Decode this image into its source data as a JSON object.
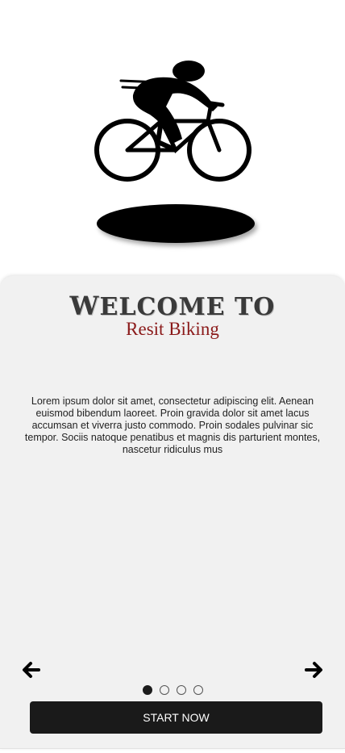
{
  "welcome": {
    "title_first": "W",
    "title_rest": "ELCOME TO",
    "subtitle": "Resit Biking",
    "description": "Lorem ipsum dolor sit amet, consectetur adipiscing elit. Aenean euismod bibendum laoreet. Proin gravida dolor sit amet lacus accumsan et viverra justo commodo. Proin sodales pulvinar sic tempor. Sociis natoque penatibus et magnis dis parturient montes, nascetur ridiculus mus"
  },
  "pager": {
    "pages": 4,
    "active_page": 1
  },
  "actions": {
    "start_label": "START NOW",
    "prev_icon": "arrow-left-icon",
    "next_icon": "arrow-right-icon"
  },
  "colors": {
    "subtitle": "#8b1a1a",
    "button_bg": "#1a1a1a",
    "card_bg": "#f1f1f1"
  }
}
